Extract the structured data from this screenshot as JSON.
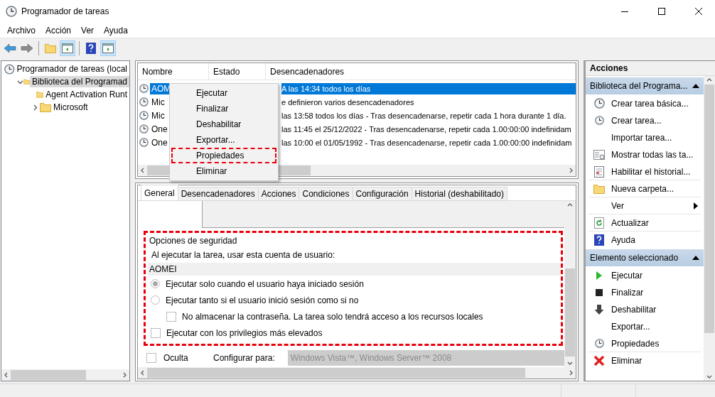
{
  "window": {
    "title": "Programador de tareas"
  },
  "menu": [
    "Archivo",
    "Acción",
    "Ver",
    "Ayuda"
  ],
  "toolbar": [
    {
      "kind": "back",
      "pressed": false
    },
    {
      "kind": "forward",
      "pressed": false
    },
    {
      "kind": "separator"
    },
    {
      "kind": "up",
      "pressed": false
    },
    {
      "kind": "tree",
      "pressed": true
    },
    {
      "kind": "separator"
    },
    {
      "kind": "help",
      "pressed": false
    },
    {
      "kind": "pane",
      "pressed": true
    }
  ],
  "tree": [
    {
      "label": "Programador de tareas (local",
      "selected": false,
      "children": [
        {
          "label": "Biblioteca del Programad",
          "selected": true,
          "expanded": true,
          "children": [
            {
              "label": "Agent Activation Runt",
              "selected": false
            },
            {
              "label": "Microsoft",
              "selected": false,
              "expanded": false
            }
          ]
        }
      ]
    }
  ],
  "task_list": {
    "columns": [
      "Nombre",
      "Estado",
      "Desencadenadores"
    ],
    "rows": [
      {
        "name": "AOM",
        "trigger": "A las 14:34 todos los días",
        "selected": true
      },
      {
        "name": "Mic",
        "trigger": "e definieron varios desencadenadores",
        "selected": false
      },
      {
        "name": "Mic",
        "trigger": "las 13:58 todos los días - Tras desencadenarse, repetir cada 1 hora durante 1 día.",
        "selected": false
      },
      {
        "name": "One",
        "trigger": "las 11:45 el 25/12/2022 - Tras desencadenarse, repetir cada 1.00:00:00 indefinidam",
        "selected": false
      },
      {
        "name": "One",
        "trigger": "las 10:00 el 01/05/1992 - Tras desencadenarse, repetir cada 1.00:00:00 indefinidam",
        "selected": false
      }
    ]
  },
  "context_menu": [
    {
      "label": "Ejecutar",
      "highlighted": false
    },
    {
      "label": "Finalizar",
      "highlighted": false
    },
    {
      "label": "Deshabilitar",
      "highlighted": false
    },
    {
      "label": "Exportar...",
      "highlighted": false
    },
    {
      "label": "Propiedades",
      "highlighted": true
    },
    {
      "label": "Eliminar",
      "highlighted": false
    }
  ],
  "detail_tabs": [
    {
      "label": "General",
      "selected": true
    },
    {
      "label": "Desencadenadores",
      "selected": false
    },
    {
      "label": "Acciones",
      "selected": false
    },
    {
      "label": "Condiciones",
      "selected": false
    },
    {
      "label": "Configuración",
      "selected": false
    },
    {
      "label": "Historial (deshabilitado)",
      "selected": false
    }
  ],
  "security": {
    "title": "Opciones de seguridad",
    "highlighted": true,
    "account_label": "Al ejecutar la tarea, usar esta cuenta de usuario:",
    "account": "AOMEI",
    "options": [
      {
        "kind": "radio",
        "label": "Ejecutar solo cuando el usuario haya iniciado sesión",
        "checked": true
      },
      {
        "kind": "radio",
        "label": "Ejecutar tanto si el usuario inició sesión como si no",
        "checked": false,
        "children": [
          {
            "kind": "checkbox",
            "label": "No almacenar la contraseña. La tarea solo tendrá acceso a los recursos locales",
            "checked": false
          }
        ]
      },
      {
        "kind": "checkbox",
        "label": "Ejecutar con los privilegios más elevados",
        "checked": false
      }
    ]
  },
  "hidden_option": {
    "label": "Oculta",
    "checked": false
  },
  "configure": {
    "label": "Configurar para:",
    "value": "Windows Vista™, Windows Server™ 2008",
    "disabled": true
  },
  "actions": {
    "title": "Acciones",
    "sections": [
      {
        "title": "Biblioteca del Programa...",
        "expanded": true,
        "items": [
          {
            "label": "Crear tarea básica...",
            "kind": "basic",
            "divider": false
          },
          {
            "label": "Crear tarea...",
            "kind": "create",
            "divider": false
          },
          {
            "label": "Importar tarea...",
            "kind": "plain",
            "divider": false
          },
          {
            "label": "Mostrar todas las ta...",
            "kind": "list",
            "divider": false
          },
          {
            "label": "Habilitar el historial...",
            "kind": "history",
            "divider": false
          },
          {
            "label": "Nueva carpeta...",
            "kind": "folder",
            "divider": true
          },
          {
            "label": "Ver",
            "kind": "submenu",
            "divider": true
          },
          {
            "label": "Actualizar",
            "kind": "refresh",
            "divider": true
          },
          {
            "label": "Ayuda",
            "kind": "help",
            "divider": true
          }
        ]
      },
      {
        "title": "Elemento seleccionado",
        "expanded": true,
        "items": [
          {
            "label": "Ejecutar",
            "kind": "run",
            "divider": false
          },
          {
            "label": "Finalizar",
            "kind": "stop",
            "divider": false
          },
          {
            "label": "Deshabilitar",
            "kind": "disable",
            "divider": false
          },
          {
            "label": "Exportar...",
            "kind": "plain",
            "divider": false
          },
          {
            "label": "Propiedades",
            "kind": "props",
            "divider": false
          },
          {
            "label": "Eliminar",
            "kind": "delete",
            "divider": true
          }
        ]
      }
    ]
  }
}
